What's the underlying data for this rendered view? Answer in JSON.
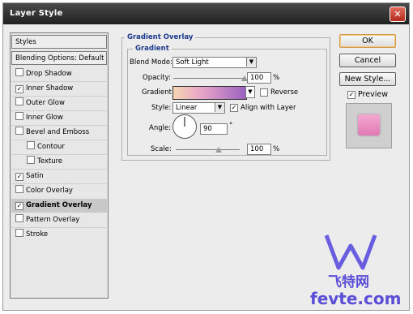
{
  "window": {
    "title": "Layer Style",
    "close_glyph": "✕"
  },
  "left_panel": {
    "styles_label": "Styles",
    "blending_label": "Blending Options: Default",
    "items": [
      {
        "label": "Drop Shadow",
        "checked": false
      },
      {
        "label": "Inner Shadow",
        "checked": true
      },
      {
        "label": "Outer Glow",
        "checked": false
      },
      {
        "label": "Inner Glow",
        "checked": false
      },
      {
        "label": "Bevel and Emboss",
        "checked": false
      },
      {
        "label": "Contour",
        "checked": false
      },
      {
        "label": "Texture",
        "checked": false
      },
      {
        "label": "Satin",
        "checked": true
      },
      {
        "label": "Color Overlay",
        "checked": false
      },
      {
        "label": "Gradient Overlay",
        "checked": true
      },
      {
        "label": "Pattern Overlay",
        "checked": false
      },
      {
        "label": "Stroke",
        "checked": false
      }
    ],
    "check_mark": "✓"
  },
  "gradient_overlay": {
    "group_title": "Gradient Overlay",
    "subgroup_title": "Gradient",
    "blend_mode_label": "Blend Mode:",
    "blend_mode_value": "Soft Light",
    "opacity_label": "Opacity:",
    "opacity_value": "100",
    "opacity_unit": "%",
    "opacity_level": 1.0,
    "gradient_label": "Gradient:",
    "reverse_label": "Reverse",
    "style_label": "Style:",
    "style_value": "Linear",
    "align_label": "Align with Layer",
    "angle_label": "Angle:",
    "angle_value": "90",
    "angle_unit": "°",
    "scale_label": "Scale:",
    "scale_value": "100",
    "scale_unit": "%",
    "scale_level": 0.67,
    "gradient_colors": [
      "#f6d6b4",
      "#e6a3c8",
      "#9a62c0"
    ]
  },
  "buttons": {
    "ok": "OK",
    "cancel": "Cancel",
    "new_style": "New Style...",
    "preview_label": "Preview"
  },
  "watermark": {
    "line1": "飞特网",
    "line2": "fevte.com"
  },
  "colors": {
    "title_bar": "#2a2a2a",
    "accent_title": "#1c3a8c",
    "close": "#c94030",
    "watermark": "#5a4ed8",
    "preview_swatch": "#eb8fc3"
  }
}
